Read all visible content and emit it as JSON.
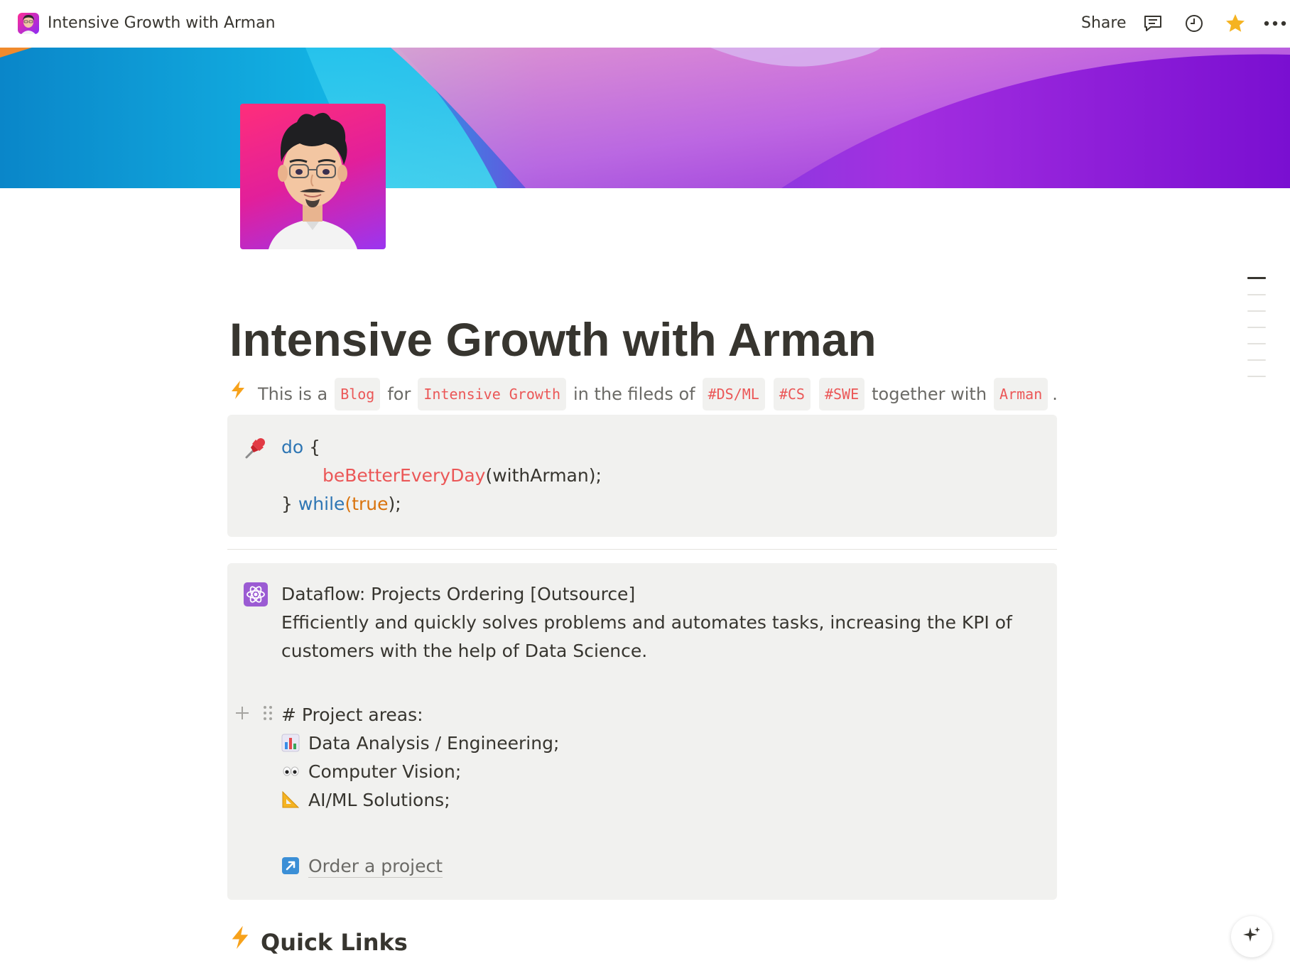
{
  "topbar": {
    "page_title": "Intensive Growth with Arman",
    "share_label": "Share"
  },
  "page": {
    "title": "Intensive Growth with Arman",
    "intro": {
      "t1": "This is a",
      "tag_blog": "Blog",
      "t2": "for",
      "tag_growth": "Intensive Growth",
      "t3": "in the fileds of",
      "tag_dsml": "#DS/ML",
      "tag_cs": "#CS",
      "tag_swe": "#SWE",
      "t4": "together with",
      "tag_arman": "Arman",
      "t5": "."
    }
  },
  "code_callout": {
    "icon": "pushpin-icon",
    "line1_kw": "do",
    "line1_rest": " {",
    "line2_fn": "beBetterEveryDay",
    "line2_rest": "(withArman);",
    "line3_pre": "} ",
    "line3_kw": "while",
    "line3_open": "(",
    "line3_lit": "true",
    "line3_close": ");"
  },
  "dataflow_callout": {
    "icon": "atom-icon",
    "title": "Dataflow: Projects Ordering [Outsource]",
    "desc_line1": "Efficiently and quickly solves problems and automates tasks, increasing the KPI of",
    "desc_line2": "customers with the help of Data Science.",
    "areas_heading": "# Project areas:",
    "areas": [
      {
        "icon": "bar-chart-icon",
        "label": "Data Analysis / Engineering;"
      },
      {
        "icon": "eyes-icon",
        "label": "Computer Vision;"
      },
      {
        "icon": "triangular-ruler-icon",
        "label": "AI/ML Solutions;"
      }
    ],
    "order_link": "Order a project"
  },
  "section": {
    "quick_links": "Quick Links"
  },
  "colors": {
    "text": "#37352f",
    "muted": "#6b6a66",
    "code_red": "#eb5757",
    "keyword_blue": "#2e76b4",
    "literal_orange": "#d9730d",
    "callout_bg": "#f1f1ef",
    "star": "#f5b321"
  }
}
